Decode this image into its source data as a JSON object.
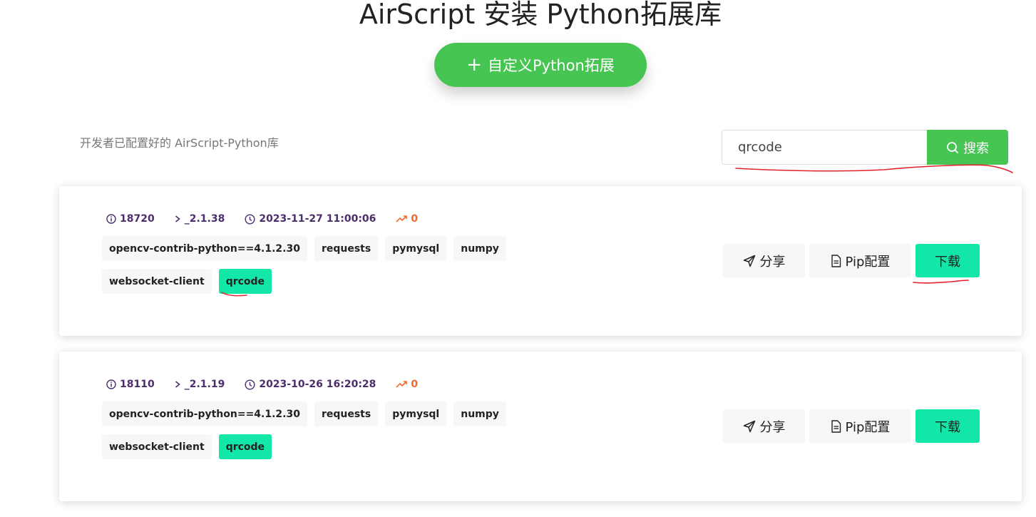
{
  "page": {
    "title": "AirScript 安装 Python拓展库",
    "add_button_label": "自定义Python拓展",
    "subtitle": "开发者已配置好的 AirScript-Python库"
  },
  "search": {
    "value": "qrcode",
    "button_label": "搜索"
  },
  "cards": [
    {
      "id": "18720",
      "version": "_2.1.38",
      "datetime": "2023-11-27 11:00:06",
      "trend": "0",
      "tags": [
        "opencv-contrib-python==4.1.2.30",
        "requests",
        "pymysql",
        "numpy",
        "websocket-client",
        "qrcode"
      ],
      "actions": {
        "share": "分享",
        "pip": "Pip配置",
        "download": "下载"
      }
    },
    {
      "id": "18110",
      "version": "_2.1.19",
      "datetime": "2023-10-26 16:20:28",
      "trend": "0",
      "tags": [
        "opencv-contrib-python==4.1.2.30",
        "requests",
        "pymysql",
        "numpy",
        "websocket-client",
        "qrcode"
      ],
      "actions": {
        "share": "分享",
        "pip": "Pip配置",
        "download": "下载"
      }
    }
  ],
  "colors": {
    "primary_green": "#47c552",
    "highlight_teal": "#13e7a8",
    "meta_purple": "#4c2d6b",
    "trend_orange": "#f06a2b",
    "annotation_red": "#e5222b"
  }
}
